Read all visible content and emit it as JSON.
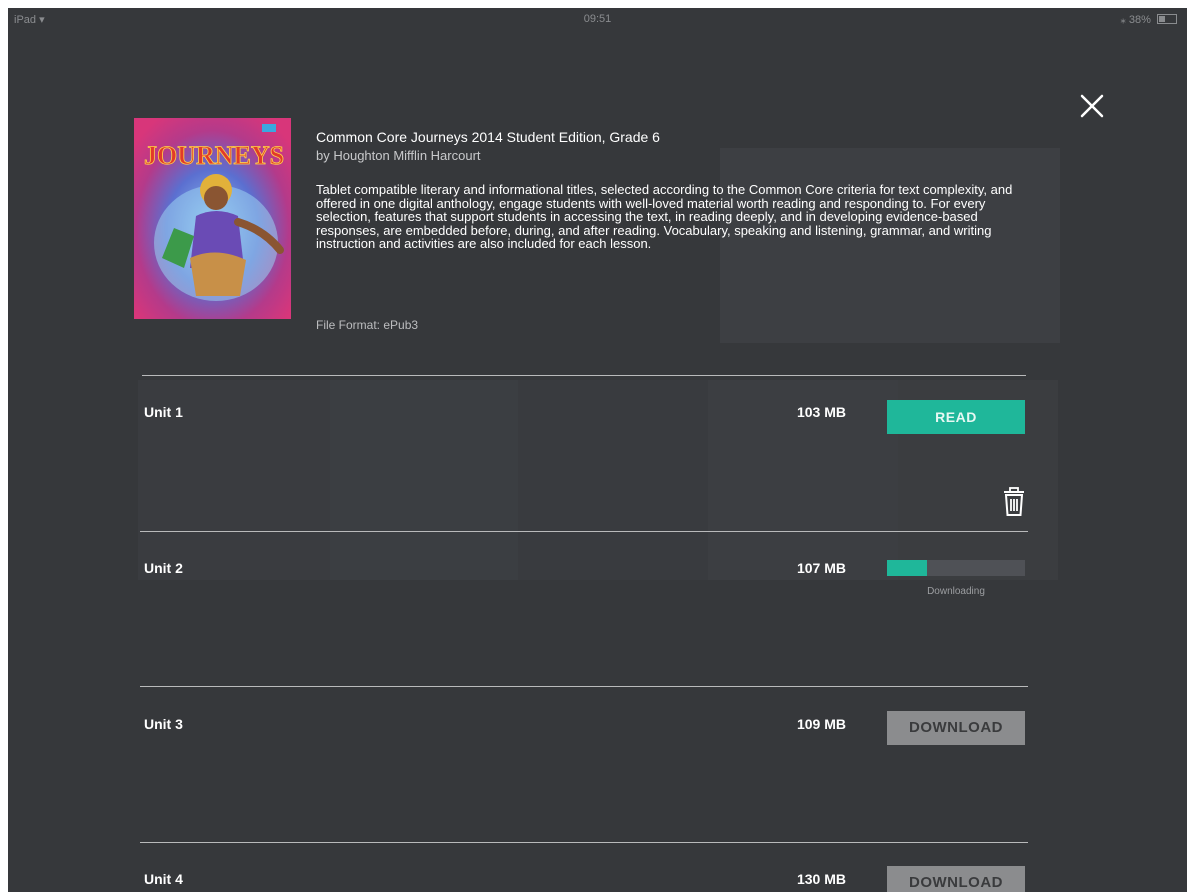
{
  "status_bar": {
    "device": "iPad",
    "time": "09:51",
    "battery": "38%"
  },
  "book": {
    "title": "Common Core Journeys 2014 Student Edition, Grade 6",
    "author": "by Houghton Mifflin Harcourt",
    "description": "Tablet compatible literary and informational titles, selected according to the Common Core criteria for text complexity, and offered in one digital anthology, engage students with well-loved material worth reading and responding to. For every selection, features that support students in accessing the text, in reading deeply, and in developing evidence-based responses, are embedded before, during, and after reading. Vocabulary, speaking and listening, grammar, and writing instruction and activities are also included for each lesson.",
    "file_format": "File Format: ePub3",
    "cover_text": "JOURNEYS"
  },
  "units": [
    {
      "name": "Unit 1",
      "size": "103 MB",
      "action": "READ"
    },
    {
      "name": "Unit 2",
      "size": "107 MB",
      "status": "Downloading",
      "progress": 0.29
    },
    {
      "name": "Unit 3",
      "size": "109 MB",
      "action": "DOWNLOAD"
    },
    {
      "name": "Unit 4",
      "size": "130 MB",
      "action": "DOWNLOAD"
    }
  ],
  "colors": {
    "background": "#36383b",
    "accent": "#1fb79a",
    "secondary_button": "#8b8c8e"
  },
  "icons": {
    "close": "close-icon",
    "delete": "trash-icon",
    "wifi": "wifi-icon",
    "bluetooth": "bluetooth-icon",
    "battery": "battery-icon"
  }
}
